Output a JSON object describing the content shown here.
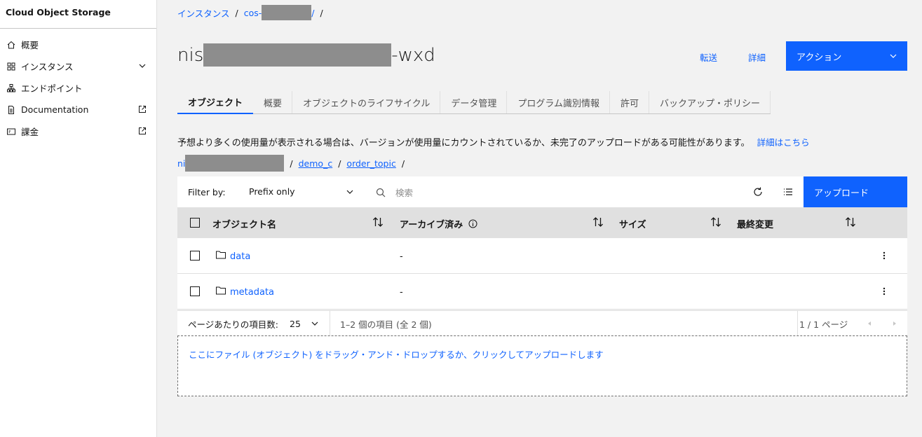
{
  "sidebar": {
    "title": "Cloud Object Storage",
    "items": [
      {
        "label": "概要",
        "icon": "home-icon"
      },
      {
        "label": "インスタンス",
        "icon": "grid-icon"
      },
      {
        "label": "エンドポイント",
        "icon": "hierarchy-icon"
      },
      {
        "label": "Documentation",
        "icon": "document-icon"
      },
      {
        "label": "課金",
        "icon": "billing-icon"
      }
    ]
  },
  "breadcrumb": {
    "item1": "インスタンス",
    "item2_prefix": "cos-",
    "item2_suffix": "/"
  },
  "header": {
    "title_prefix": "nis",
    "title_suffix": "-wxd",
    "transfer_label": "転送",
    "details_label": "詳細",
    "actions_label": "アクション"
  },
  "tabs": [
    {
      "label": "オブジェクト",
      "active": true
    },
    {
      "label": "概要"
    },
    {
      "label": "オブジェクトのライフサイクル"
    },
    {
      "label": "データ管理"
    },
    {
      "label": "プログラム識別情報"
    },
    {
      "label": "許可"
    },
    {
      "label": "バックアップ・ポリシー"
    }
  ],
  "notice": {
    "text": "予想より多くの使用量が表示される場合は、バージョンが使用量にカウントされているか、未完了のアップロードがある可能性があります。",
    "link": "詳細はこちら"
  },
  "path": {
    "root_prefix": "ni",
    "segments": [
      "demo_c",
      "order_topic"
    ]
  },
  "toolbar": {
    "filter_label": "Filter by:",
    "filter_value": "Prefix only",
    "search_placeholder": "検索",
    "upload_label": "アップロード"
  },
  "table": {
    "headers": [
      "オブジェクト名",
      "アーカイブ済み",
      "サイズ",
      "最終変更"
    ],
    "rows": [
      {
        "name": "data",
        "archived": "-"
      },
      {
        "name": "metadata",
        "archived": "-"
      }
    ]
  },
  "pagination": {
    "per_page_label": "ページあたりの項目数:",
    "per_page_value": "25",
    "range_text": "1–2 個の項目 (全 2 個)",
    "page_text": "1 / 1 ページ"
  },
  "dropzone": {
    "text": "ここにファイル (オブジェクト) をドラッグ・アンド・ドロップするか、クリックしてアップロードします"
  },
  "colors": {
    "primary": "#0f62fe",
    "background": "#f2f2f2",
    "header_row": "#e0e0e0"
  }
}
